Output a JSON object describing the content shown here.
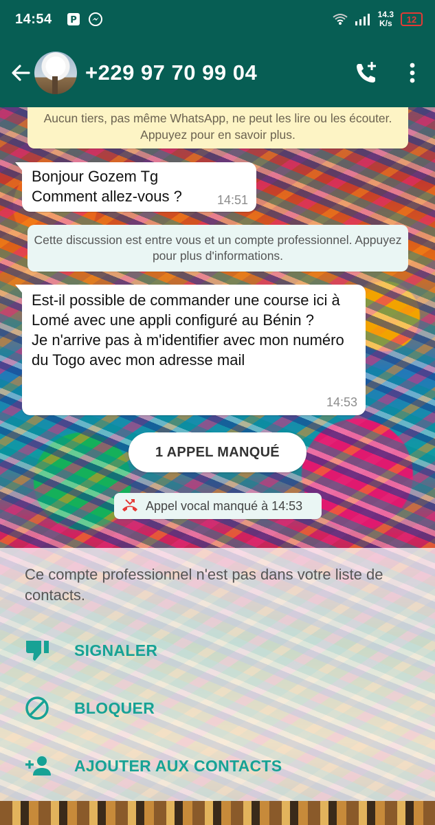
{
  "status_bar": {
    "time": "14:54",
    "net_speed_value": "14.3",
    "net_speed_unit": "K/s",
    "battery": "12",
    "battery_color": "#e53935"
  },
  "header": {
    "contact": "+229 97 70 99 04",
    "icons": [
      "back-arrow-icon",
      "add-call-icon",
      "more-vert-icon"
    ],
    "color": "#075e54"
  },
  "chat": {
    "encryption_notice": "Aucun tiers, pas même WhatsApp, ne peut les lire ou les écouter. Appuyez pour en savoir plus.",
    "messages": [
      {
        "text": "Bonjour Gozem Tg\nComment allez-vous ?",
        "time": "14:51"
      },
      {
        "text": "Est-il possible de commander une course ici à Lomé avec une appli configuré au Bénin ?\nJe n'arrive pas à m'identifier avec mon numéro du Togo avec mon adresse mail",
        "time": "14:53"
      }
    ],
    "business_notice": "Cette discussion est entre vous et un compte professionnel. Appuyez pour plus d'informations.",
    "missed_calls_label": "1 APPEL MANQUÉ",
    "missed_call_entry": "Appel vocal manqué à 14:53"
  },
  "business_sheet": {
    "note": "Ce compte professionnel n'est pas dans votre liste de contacts.",
    "report_label": "SIGNALER",
    "block_label": "BLOQUER",
    "add_label": "AJOUTER AUX CONTACTS",
    "accent": "#17a295"
  }
}
